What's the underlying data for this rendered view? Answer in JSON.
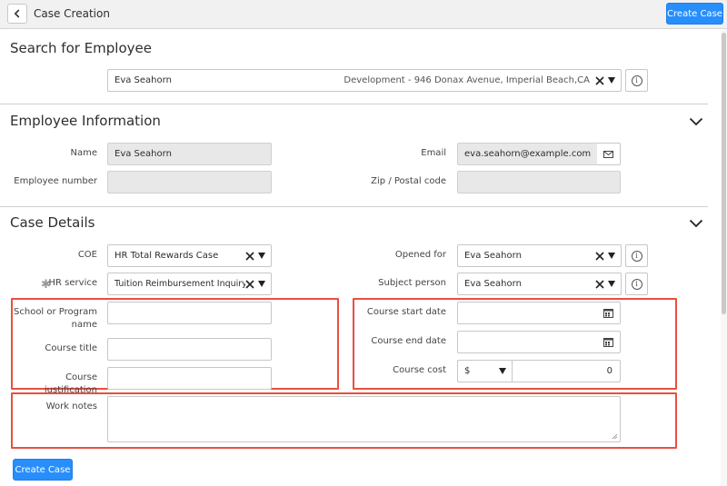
{
  "header": {
    "title": "Case Creation",
    "create_label": "Create Case"
  },
  "search": {
    "title": "Search for Employee",
    "employee_name": "Eva Seahorn",
    "employee_detail": "Development - 946 Donax Avenue, Imperial Beach,CA"
  },
  "employee_info": {
    "title": "Employee Information",
    "name_label": "Name",
    "name_value": "Eva Seahorn",
    "email_label": "Email",
    "email_value": "eva.seahorn@example.com",
    "employee_number_label": "Employee number",
    "employee_number_value": "",
    "zip_label": "Zip / Postal code",
    "zip_value": ""
  },
  "case_details": {
    "title": "Case Details",
    "coe_label": "COE",
    "coe_value": "HR Total Rewards Case",
    "hr_service_label": "HR service",
    "hr_service_value": "Tuition Reimbursement Inquiry",
    "opened_for_label": "Opened for",
    "opened_for_value": "Eva Seahorn",
    "subject_person_label": "Subject person",
    "subject_person_value": "Eva Seahorn",
    "school_label_line1": "School or Program",
    "school_label_line2": "name",
    "course_title_label": "Course title",
    "course_justification_label": "Course justification",
    "course_start_label": "Course start date",
    "course_end_label": "Course end date",
    "course_cost_label": "Course cost",
    "currency_value": "$",
    "cost_value": "0",
    "work_notes_label": "Work notes",
    "mandatory_marker": "✱"
  },
  "footer": {
    "create_label": "Create Case"
  },
  "colors": {
    "accent": "#278efc",
    "highlight": "#e8503e"
  }
}
